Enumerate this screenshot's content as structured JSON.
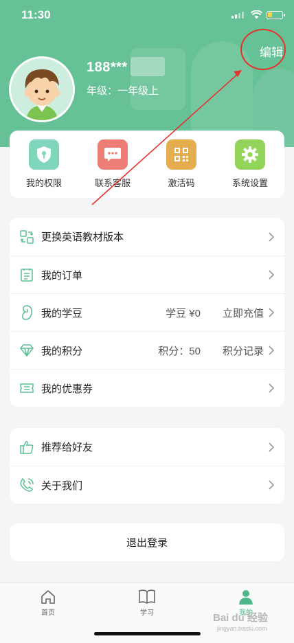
{
  "status_bar": {
    "time": "11:30"
  },
  "profile": {
    "phone": "188***",
    "grade": "年级：一年级上",
    "edit_label": "编辑"
  },
  "quick_actions": [
    {
      "label": "我的权限",
      "icon": "shield-icon",
      "color": "#7fd6bd"
    },
    {
      "label": "联系客服",
      "icon": "chat-icon",
      "color": "#ec7e76"
    },
    {
      "label": "激活码",
      "icon": "qr-code-icon",
      "color": "#e6ad4e"
    },
    {
      "label": "系统设置",
      "icon": "gear-icon",
      "color": "#93d45a"
    }
  ],
  "menu_section_1": [
    {
      "label": "更换英语教材版本",
      "icon": "swap-book-icon"
    },
    {
      "label": "我的订单",
      "icon": "order-list-icon"
    },
    {
      "label": "我的学豆",
      "icon": "bean-icon",
      "value": "学豆 ¥0",
      "action": "立即充值"
    },
    {
      "label": "我的积分",
      "icon": "diamond-icon",
      "value": "积分：50",
      "action": "积分记录"
    },
    {
      "label": "我的优惠券",
      "icon": "coupon-icon"
    }
  ],
  "menu_section_2": [
    {
      "label": "推荐给好友",
      "icon": "thumbs-up-icon"
    },
    {
      "label": "关于我们",
      "icon": "phone-icon"
    }
  ],
  "logout_label": "退出登录",
  "tabs": [
    {
      "label": "首页",
      "icon": "home-icon"
    },
    {
      "label": "学习",
      "icon": "book-icon"
    },
    {
      "label": "我的",
      "icon": "user-icon"
    }
  ],
  "watermark": {
    "text": "Bai du 经验",
    "sub": "jingyan.baidu.com"
  },
  "colors": {
    "brand_green": "#66c196",
    "annotation_red": "#e4332f"
  }
}
